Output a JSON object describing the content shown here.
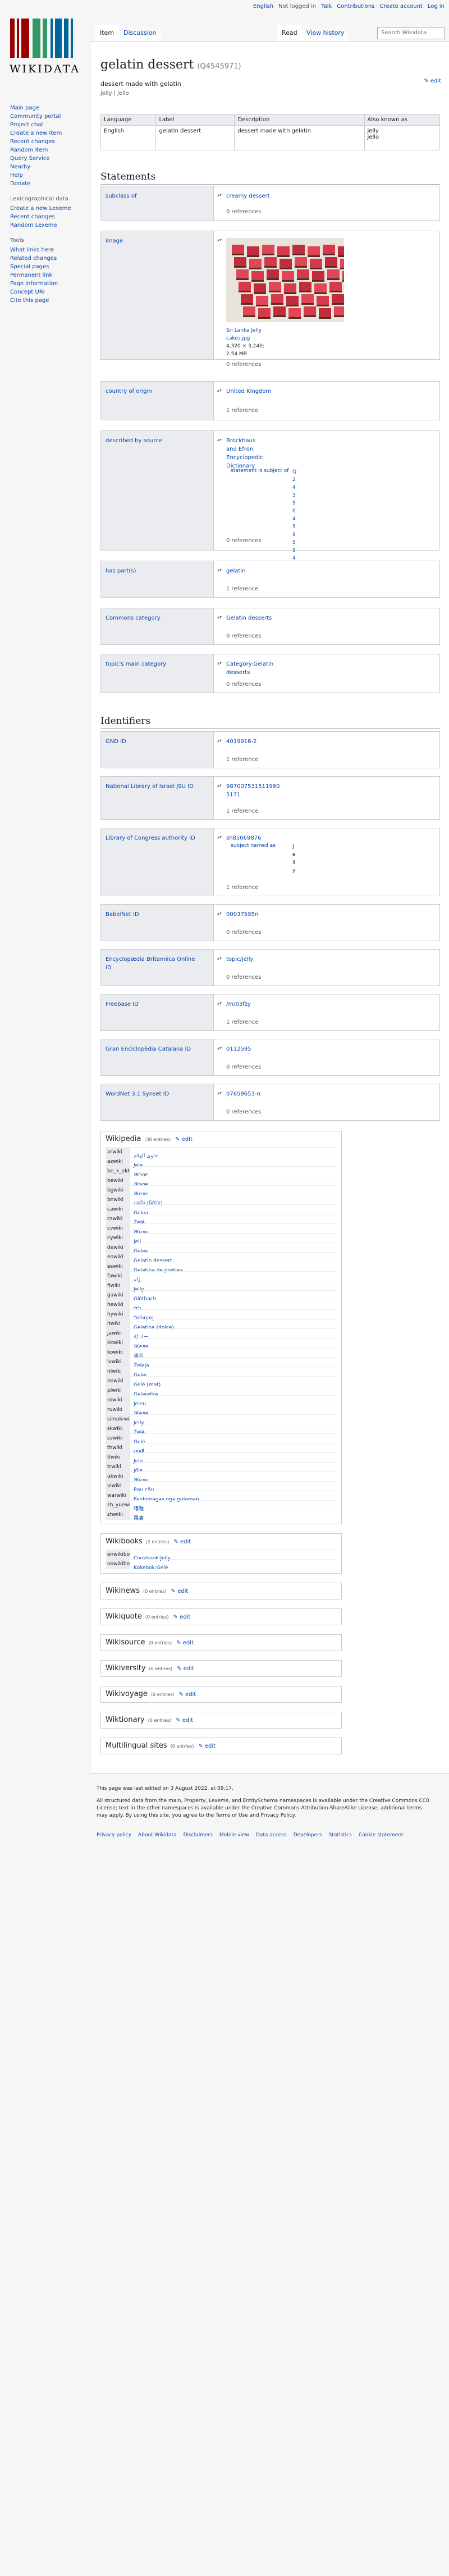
{
  "site": {
    "wordmark": "WIKIDATA"
  },
  "personal": {
    "language": "English",
    "not_logged": "Not logged in",
    "talk": "Talk",
    "contributions": "Contributions",
    "create_account": "Create account",
    "login": "Log in"
  },
  "tabs": {
    "item": "Item",
    "discussion": "Discussion",
    "read": "Read",
    "history": "View history"
  },
  "search": {
    "placeholder": "Search Wikidata"
  },
  "sidebar": {
    "main": [
      "Main page",
      "Community portal",
      "Project chat",
      "Create a new Item",
      "Recent changes",
      "Random Item",
      "Query Service",
      "Nearby",
      "Help",
      "Donate"
    ],
    "lexicographical_heading": "Lexicographical data",
    "lexicographical": [
      "Create a new Lexeme",
      "Recent changes",
      "Random Lexeme"
    ],
    "tools_heading": "Tools",
    "tools": [
      "What links here",
      "Related changes",
      "Special pages",
      "Permanent link",
      "Page information",
      "Concept URI",
      "Cite this page"
    ]
  },
  "item": {
    "title": "gelatin dessert",
    "qid": "(Q4545971)",
    "description": "dessert made with gelatin",
    "aliases": "jelly | jello",
    "edit": "edit"
  },
  "labels_table": {
    "headers": [
      "Language",
      "Label",
      "Description",
      "Also known as"
    ],
    "row": {
      "language": "English",
      "label": "gelatin dessert",
      "description": "dessert made with gelatin",
      "aka1": "jelly",
      "aka2": "jello"
    }
  },
  "statements_heading": "Statements",
  "identifiers_heading": "Identifiers",
  "statements": [
    {
      "prop": "subclass of",
      "value": "creamy dessert",
      "refs": "0 references"
    },
    {
      "prop": "image",
      "value": "Sri Lanka Jelly cakes.jpg",
      "size": "4,320 × 3,240;",
      "filesize": "2.54 MB",
      "refs": "0 references"
    },
    {
      "prop": "country of origin",
      "value": "United Kingdom",
      "refs": "1 reference"
    },
    {
      "prop": "described by source",
      "value": "Brockhaus and Efron Encyclopedic Dictionary",
      "qualifier": "statement is subject of",
      "qualifier_value": "Q24390459594",
      "refs": "0 references"
    },
    {
      "prop": "has part(s)",
      "value": "gelatin",
      "refs": "1 reference"
    },
    {
      "prop": "Commons category",
      "value": "Gelatin desserts",
      "refs": "0 references"
    },
    {
      "prop": "topic's main category",
      "value": "Category:Gelatin desserts",
      "refs": "0 references"
    }
  ],
  "identifiers": [
    {
      "prop": "GND ID",
      "value": "4019916-2",
      "refs": "1 reference"
    },
    {
      "prop": "National Library of Israel J9U ID",
      "value": "987007531511960 5171",
      "refs": "1 reference"
    },
    {
      "prop": "Library of Congress authority ID",
      "value": "sh85069876",
      "qualifier": "subject named as",
      "qualifier_value": "Jelly",
      "refs": "1 reference"
    },
    {
      "prop": "BabelNet ID",
      "value": "00037595n",
      "refs": "0 references"
    },
    {
      "prop": "Encyclopædia Britannica Online ID",
      "value": "topic/jelly",
      "refs": "0 references"
    },
    {
      "prop": "Freebase ID",
      "value": "/m/03fzy",
      "refs": "1 reference"
    },
    {
      "prop": "Gran Enciclopèdia Catalana ID",
      "value": "0112595",
      "refs": "0 references"
    },
    {
      "prop": "WordNet 3.1 Synset ID",
      "value": "07659653-n",
      "refs": "0 references"
    }
  ],
  "wikipedia": {
    "title": "Wikipedia",
    "count": "(38 entries)",
    "edit": "edit",
    "rows": [
      [
        "arwiki",
        "حلوى الهلام"
      ],
      [
        "azwiki",
        "Jele"
      ],
      [
        "be_x_oldwiki",
        "Жэле"
      ],
      [
        "bewiki",
        "Жэле"
      ],
      [
        "bgwiki",
        "Желе"
      ],
      [
        "bnwiki",
        "জেলি (মিষ্টান্ন)"
      ],
      [
        "cawiki",
        "Gelea"
      ],
      [
        "cswiki",
        "Želé"
      ],
      [
        "cvwiki",
        "Желе"
      ],
      [
        "cywiki",
        "Jeli"
      ],
      [
        "dewiki",
        "Gelee"
      ],
      [
        "enwiki",
        "Gelatin dessert"
      ],
      [
        "eswiki",
        "Gelatina de postres"
      ],
      [
        "fawiki",
        "ژله"
      ],
      [
        "fiwiki",
        "Jelly"
      ],
      [
        "gawiki",
        "Glóthach"
      ],
      [
        "hewiki",
        "ג'לי"
      ],
      [
        "hywiki",
        "Դոնդող"
      ],
      [
        "itwiki",
        "Gelatina (dolce)"
      ],
      [
        "jawiki",
        "ゼリー"
      ],
      [
        "kkwiki",
        "Желе"
      ],
      [
        "kowiki",
        "젤리"
      ],
      [
        "lvwiki",
        "Želeja"
      ],
      [
        "nlwiki",
        "Gelei"
      ],
      [
        "nowiki",
        "Gelé (mat)"
      ],
      [
        "plwiki",
        "Galaretka"
      ],
      [
        "rowiki",
        "Jeleu"
      ],
      [
        "ruwiki",
        "Желе"
      ],
      [
        "simplewiki",
        "Jelly"
      ],
      [
        "skwiki",
        "Želé"
      ],
      [
        "svwiki",
        "Gelé"
      ],
      [
        "thwiki",
        "เยลลี่"
      ],
      [
        "tlwiki",
        "Jelo"
      ],
      [
        "trwiki",
        "Jöle"
      ],
      [
        "ukwiki",
        "Желе"
      ],
      [
        "viwiki",
        "Rau câu"
      ],
      [
        "warwiki",
        "Panhimagas nga gulaman"
      ],
      [
        "zh_yuewiki",
        "啫喱"
      ],
      [
        "zhwiki",
        "果凍"
      ]
    ]
  },
  "wikibooks": {
    "title": "Wikibooks",
    "count": "(2 entries)",
    "edit": "edit",
    "rows": [
      [
        "enwikibooks",
        "Cookbook:Jelly"
      ],
      [
        "nowikibooks",
        "Kokebok:Gelé"
      ]
    ]
  },
  "other_sitelinks": [
    {
      "title": "Wikinews",
      "count": "(0 entries)",
      "edit": "edit"
    },
    {
      "title": "Wikiquote",
      "count": "(0 entries)",
      "edit": "edit"
    },
    {
      "title": "Wikisource",
      "count": "(0 entries)",
      "edit": "edit"
    },
    {
      "title": "Wikiversity",
      "count": "(0 entries)",
      "edit": "edit"
    },
    {
      "title": "Wikivoyage",
      "count": "(0 entries)",
      "edit": "edit"
    },
    {
      "title": "Wiktionary",
      "count": "(0 entries)",
      "edit": "edit"
    },
    {
      "title": "Multilingual sites",
      "count": "(0 entries)",
      "edit": "edit"
    }
  ],
  "footer": {
    "last_edited": "This page was last edited on 3 August 2022, at 09:17.",
    "license": "All structured data from the main, Property, Lexeme, and EntitySchema namespaces is available under the Creative Commons CC0 License; text in the other namespaces is available under the Creative Commons Attribution-ShareAlike License; additional terms may apply. By using this site, you agree to the Terms of Use and Privacy Policy.",
    "links": [
      "Privacy policy",
      "About Wikidata",
      "Disclaimers",
      "Mobile view",
      "Data access",
      "Developers",
      "Statistics",
      "Cookie statement"
    ]
  }
}
